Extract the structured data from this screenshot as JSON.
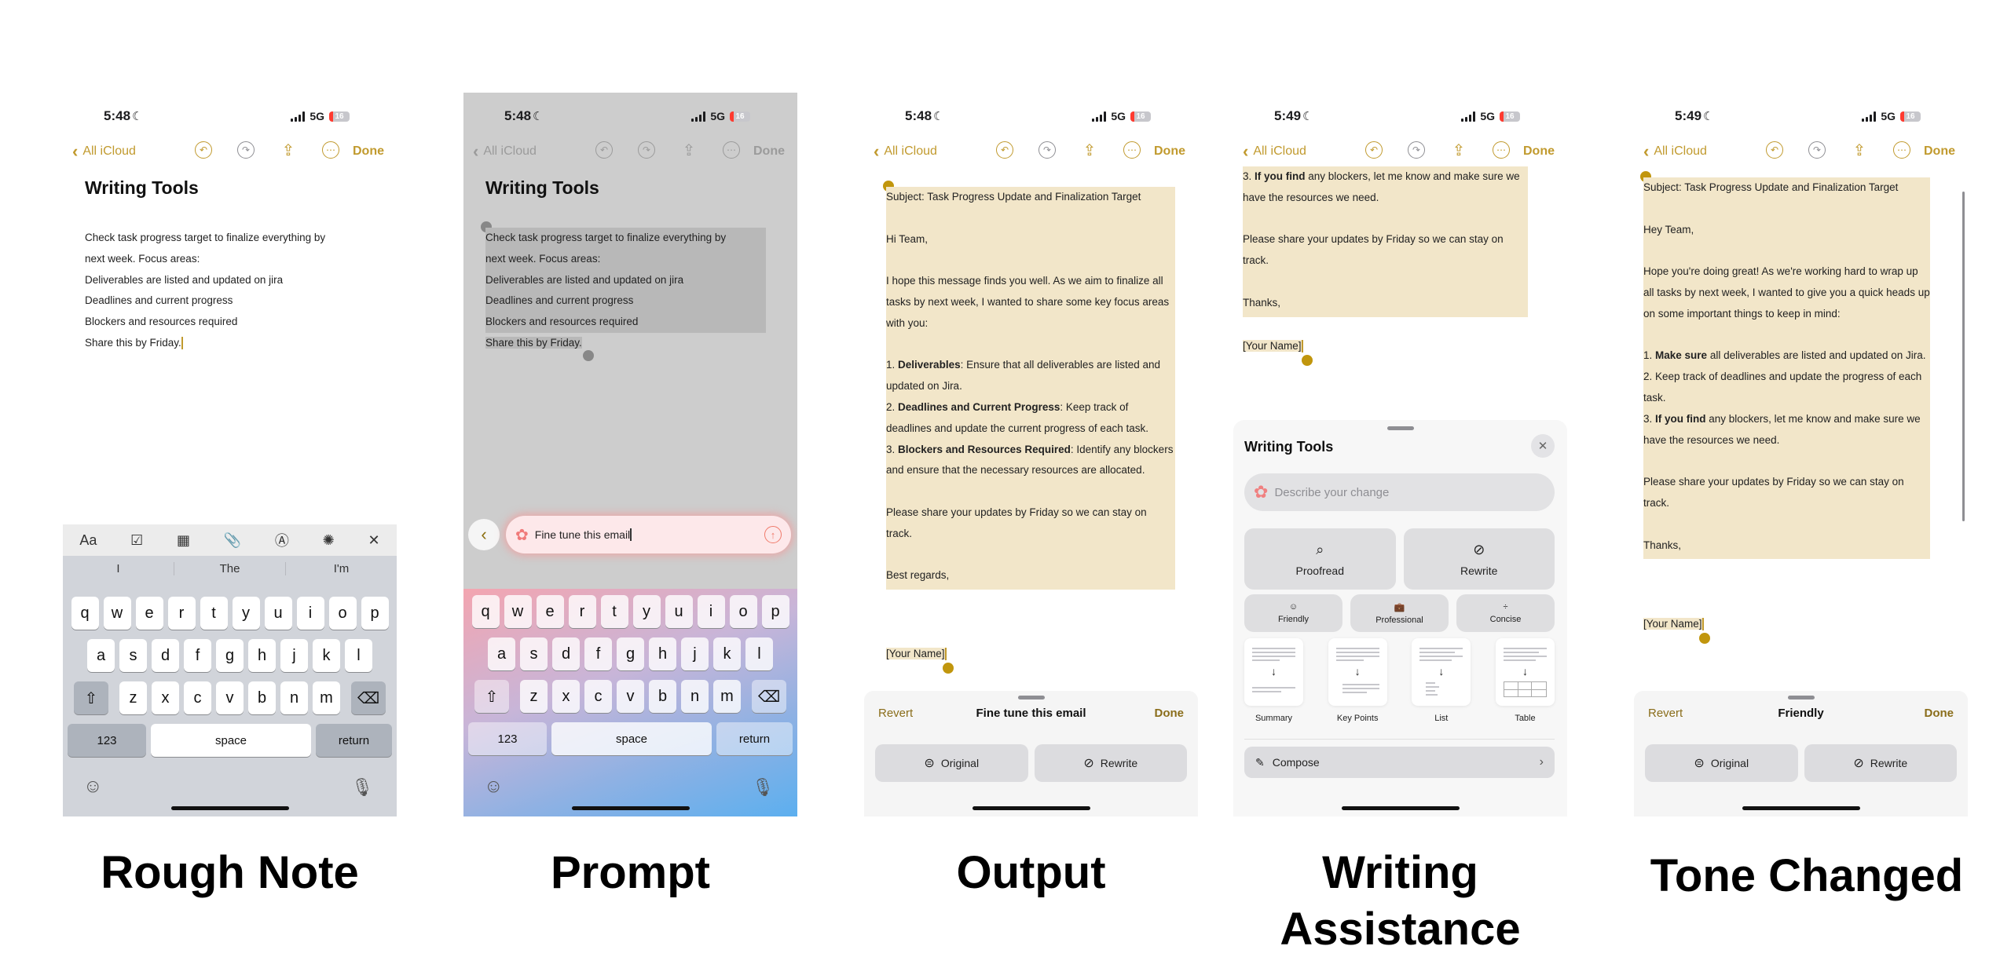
{
  "colors": {
    "accent": "#c19a2e",
    "highlight": "#f2e6c9",
    "battery_low": "#ff3b30"
  },
  "captions": [
    "Rough Note",
    "Prompt",
    "Output",
    "Writing Assistance",
    "Tone Changed"
  ],
  "status": {
    "time_548": "5:48",
    "time_549": "5:49",
    "network": "5G",
    "battery": "16",
    "focus_icon": "moon-icon"
  },
  "nav": {
    "back_label": "All iCloud",
    "done_label": "Done",
    "icons": [
      "undo-icon",
      "redo-icon",
      "share-icon",
      "more-icon"
    ]
  },
  "note": {
    "title": "Writing Tools",
    "lines": [
      "Check task progress target to finalize everything by",
      "next week. Focus areas:",
      "Deliverables are listed and updated on jira",
      "Deadlines and current progress",
      "Blockers and resources required",
      "Share this by Friday."
    ]
  },
  "keyboard": {
    "toolbar": [
      "Aa",
      "checklist-icon",
      "table-icon",
      "attachment-icon",
      "markup-icon",
      "writing-tools-icon",
      "close-icon"
    ],
    "suggestions": [
      "I",
      "The",
      "I'm"
    ],
    "row1": [
      "q",
      "w",
      "e",
      "r",
      "t",
      "y",
      "u",
      "i",
      "o",
      "p"
    ],
    "row2": [
      "a",
      "s",
      "d",
      "f",
      "g",
      "h",
      "j",
      "k",
      "l"
    ],
    "row3": [
      "z",
      "x",
      "c",
      "v",
      "b",
      "n",
      "m"
    ],
    "numbers_label": "123",
    "space_label": "space",
    "return_label": "return"
  },
  "prompt": {
    "value": "Fine tune this email"
  },
  "output": {
    "subject": "Subject: Task Progress Update and Finalization Target",
    "greeting": "Hi Team,",
    "intro": "I hope this message finds you well. As we aim to finalize all tasks by next week, I wanted to share some key focus areas with you:",
    "items": [
      {
        "num": "1.",
        "bold": "Deliverables",
        "rest": ": Ensure that all deliverables are listed and updated on Jira."
      },
      {
        "num": "2.",
        "bold": "Deadlines and Current Progress",
        "rest": ": Keep track of deadlines and update the current progress of each task."
      },
      {
        "num": "3.",
        "bold": "Blockers and Resources Required",
        "rest": ": Identify any blockers and ensure that the necessary resources are allocated."
      }
    ],
    "closing_line": "Please share your updates by Friday so we can stay on track.",
    "signoff": "Best regards,",
    "name": "[Your Name]"
  },
  "sheet_output": {
    "revert_label": "Revert",
    "title": "Fine tune this email",
    "done_label": "Done",
    "original_label": "Original",
    "rewrite_label": "Rewrite"
  },
  "writing_assist": {
    "preview": {
      "item3_num": "3.",
      "item3_bold": "If you find",
      "item3_rest": " any blockers, let me know and make sure we have the resources we need.",
      "closing_line": "Please share your updates by Friday so we can stay on track.",
      "signoff": "Thanks,",
      "name": "[Your Name]"
    },
    "title": "Writing Tools",
    "input_placeholder": "Describe your change",
    "proofread_label": "Proofread",
    "rewrite_label": "Rewrite",
    "tones": [
      "Friendly",
      "Professional",
      "Concise"
    ],
    "formats": [
      "Summary",
      "Key Points",
      "List",
      "Table"
    ],
    "compose_label": "Compose"
  },
  "tone_changed": {
    "subject": "Subject: Task Progress Update and Finalization Target",
    "greeting": "Hey Team,",
    "intro": "Hope you're doing great! As we're working hard to wrap up all tasks by next week, I wanted to give you a quick heads up on some important things to keep in mind:",
    "items": [
      {
        "num": "1.",
        "bold": "Make sure",
        "rest": " all deliverables are listed and updated on Jira."
      },
      {
        "num": "2.",
        "bold": "",
        "rest": " Keep track of deadlines and update the progress of each task."
      },
      {
        "num": "3.",
        "bold": "If you find",
        "rest": " any blockers, let me know and make sure we have the resources we need."
      }
    ],
    "closing_line": "Please share your updates by Friday so we can stay on track.",
    "signoff": "Thanks,",
    "name": "[Your Name]"
  },
  "sheet_tone": {
    "revert_label": "Revert",
    "title": "Friendly",
    "done_label": "Done",
    "original_label": "Original",
    "rewrite_label": "Rewrite"
  }
}
